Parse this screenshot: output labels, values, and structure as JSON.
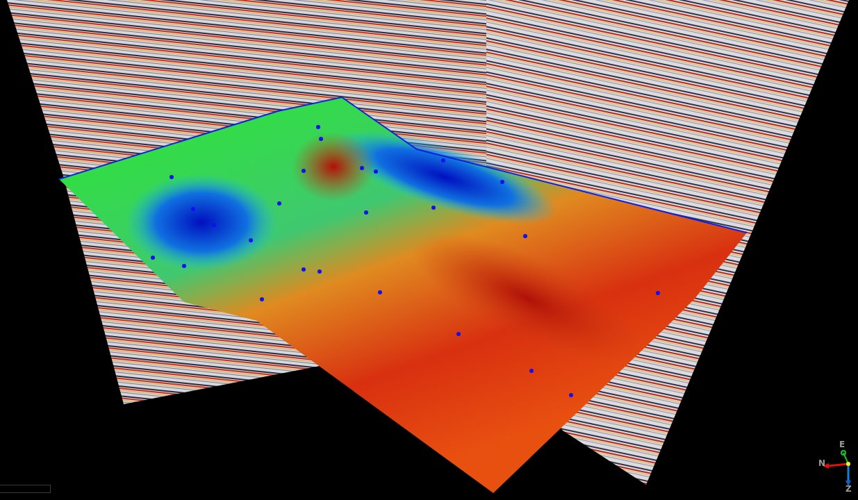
{
  "viewport": {
    "orientation_axes": [
      {
        "label": "E"
      },
      {
        "label": "N"
      },
      {
        "label": "Z"
      }
    ]
  }
}
